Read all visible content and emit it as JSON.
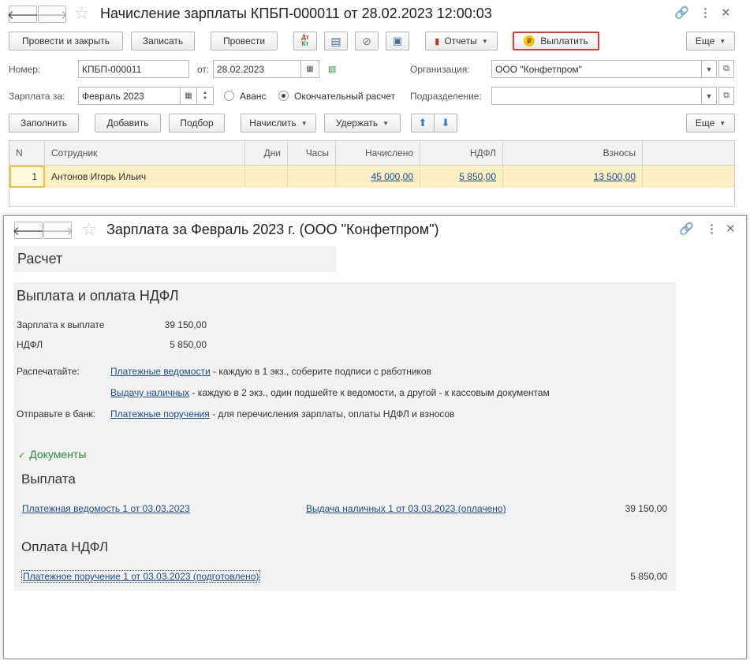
{
  "doc": {
    "title": "Начисление зарплаты КПБП-000011 от 28.02.2023 12:00:03",
    "toolbar": {
      "post_close": "Провести и закрыть",
      "save": "Записать",
      "post": "Провести",
      "reports": "Отчеты",
      "pay": "Выплатить",
      "more": "Еще"
    },
    "fields": {
      "number_label": "Номер:",
      "number_value": "КПБП-000011",
      "date_label": "от:",
      "date_value": "28.02.2023",
      "org_label": "Организация:",
      "org_value": "ООО \"Конфетпром\"",
      "salary_for_label": "Зарплата за:",
      "salary_for_value": "Февраль 2023",
      "advance_label": "Аванс",
      "final_label": "Окончательный расчет",
      "dept_label": "Подразделение:",
      "dept_value": ""
    },
    "table_toolbar": {
      "fill": "Заполнить",
      "add": "Добавить",
      "select": "Подбор",
      "accrue": "Начислить",
      "withhold": "Удержать",
      "more": "Еще"
    },
    "table": {
      "headers": [
        "N",
        "Сотрудник",
        "Дни",
        "Часы",
        "Начислено",
        "НДФЛ",
        "Взносы"
      ],
      "rows": [
        {
          "n": "1",
          "employee": "Антонов Игорь Ильич",
          "days": "",
          "hours": "",
          "accrued": "45 000,00",
          "ndfl": "5 850,00",
          "contrib": "13 500,00"
        }
      ]
    }
  },
  "pay": {
    "title": "Зарплата за Февраль 2023 г. (ООО \"Конфетпром\")",
    "calc_heading": "Расчет",
    "section_heading": "Выплата и оплата НДФЛ",
    "salary_label": "Зарплата к выплате",
    "salary_value": "39 150,00",
    "ndfl_label": "НДФЛ",
    "ndfl_value": "5 850,00",
    "print_label": "Распечатайте:",
    "print_link1": "Платежные ведомости",
    "print_text1": " - каждую в 1 экз., соберите подписи с работников",
    "print_link2": "Выдачу наличных",
    "print_text2": " - каждую в 2 экз., один подшейте к ведомости, а другой - к кассовым документам",
    "bank_label": "Отправьте в банк:",
    "bank_link": "Платежные поручения",
    "bank_text": " - для перечисления зарплаты, оплаты НДФЛ и взносов",
    "documents_toggle": "Документы",
    "payout_heading": "Выплата",
    "payout_doc1": "Платежная ведомость 1 от 03.03.2023",
    "payout_doc2": "Выдача наличных 1 от 03.03.2023 (оплачено)",
    "payout_sum": "39 150,00",
    "ndfl_heading": "Оплата НДФЛ",
    "ndfl_doc": "Платежное поручение 1 от 03.03.2023 (подготовлено)",
    "ndfl_sum": "5 850,00"
  },
  "colors": {
    "accent_red": "#e03a3a",
    "link_blue": "#1a4d8f",
    "row_highlight": "#fbefc3",
    "green": "#2e8b3a"
  }
}
